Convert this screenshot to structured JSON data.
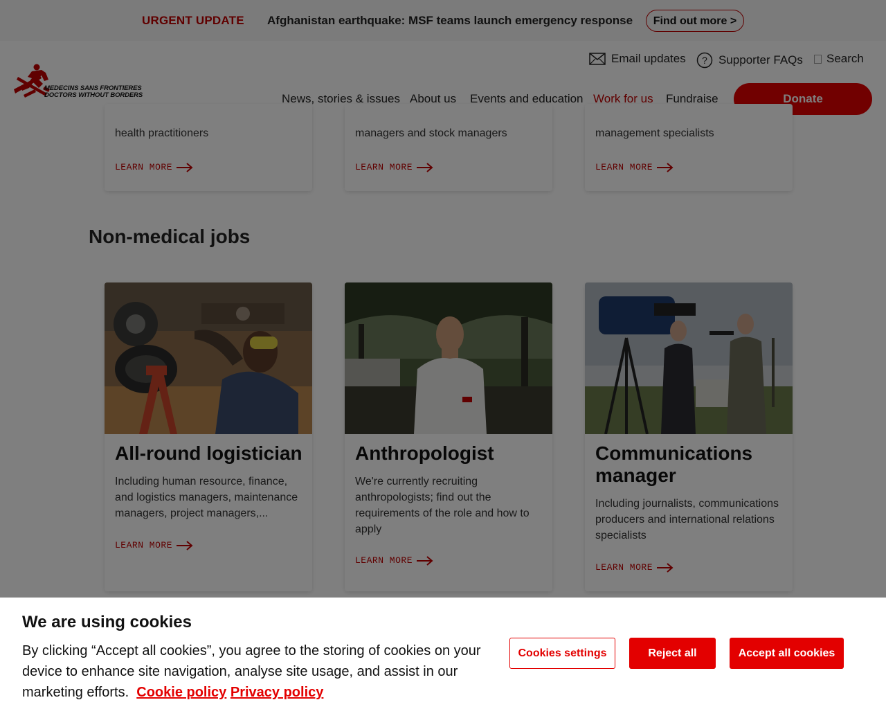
{
  "urgent": {
    "label": "URGENT UPDATE",
    "text": "Afghanistan earthquake: MSF teams launch emergency response",
    "button": "Find out more >"
  },
  "header": {
    "logo_line1": "MEDECINS SANS FRONTIERES",
    "logo_line2": "DOCTORS WITHOUT BORDERS",
    "email_updates": "Email updates",
    "supporter_faqs": "Supporter FAQs",
    "search": "Search",
    "nav": [
      "News, stories & issues",
      "About us",
      "Events and education",
      "Work for us",
      "Fundraise"
    ],
    "donate": "Donate",
    "brand_color": "#e30000"
  },
  "top_cards": [
    {
      "desc": "health practitioners",
      "cta": "LEARN MORE"
    },
    {
      "desc": "managers and stock managers",
      "cta": "LEARN MORE"
    },
    {
      "desc": "management specialists",
      "cta": "LEARN MORE"
    }
  ],
  "section": {
    "title": "Non-medical jobs"
  },
  "jobs": [
    {
      "title": "All-round logistician",
      "desc": "Including human resource, finance, and logistics managers, maintenance managers, project managers,...",
      "cta": "LEARN MORE"
    },
    {
      "title": "Anthropologist",
      "desc": "We're currently recruiting anthropologists; find out the requirements of the role and how to apply",
      "cta": "LEARN MORE"
    },
    {
      "title": "Communications manager",
      "desc": "Including journalists, communications producers and international relations specialists",
      "cta": "LEARN MORE"
    }
  ],
  "cookie": {
    "title": "We are using cookies",
    "body": "By clicking “Accept all cookies”, you agree to the storing of cookies on your device to enhance site navigation, analyse site usage, and assist in our marketing efforts.",
    "cookie_policy": "Cookie policy",
    "privacy_policy": "Privacy policy",
    "settings": "Cookies settings",
    "reject": "Reject all",
    "accept": "Accept all cookies"
  }
}
